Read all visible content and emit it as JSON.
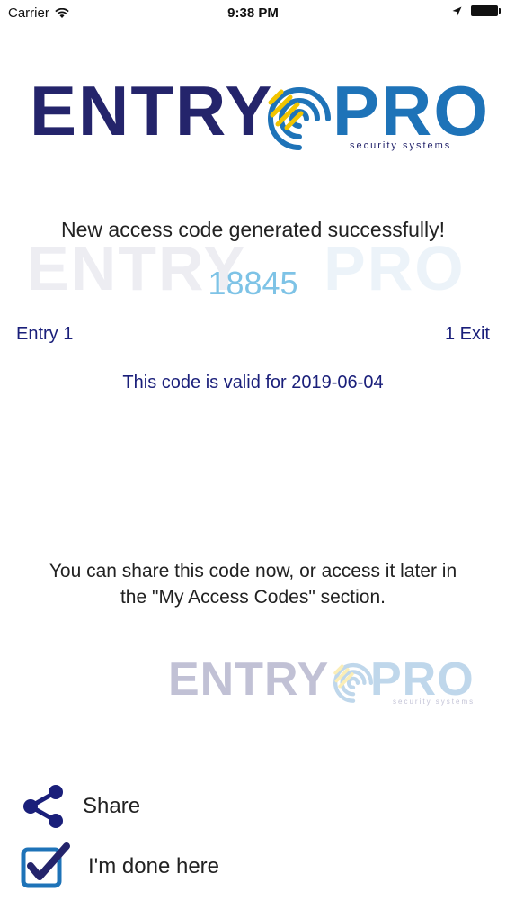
{
  "status_bar": {
    "carrier": "Carrier",
    "time": "9:38 PM"
  },
  "logo": {
    "word_left": "ENTRY",
    "word_right": "PRO",
    "tagline": "security systems"
  },
  "message": {
    "success": "New access code generated successfully!",
    "code": "18845",
    "entry_label": "Entry 1",
    "exit_label": "1 Exit",
    "validity": "This code is valid for 2019-06-04",
    "share_info_line1": "You can share this code now, or access it later in",
    "share_info_line2": "the \"My Access Codes\" section."
  },
  "actions": {
    "share_label": "Share",
    "done_label": "I'm done here"
  },
  "colors": {
    "brand_navy": "#24246b",
    "brand_blue": "#1e73b8",
    "code_color": "#7ec3e6",
    "link_navy": "#1a1f7a"
  }
}
